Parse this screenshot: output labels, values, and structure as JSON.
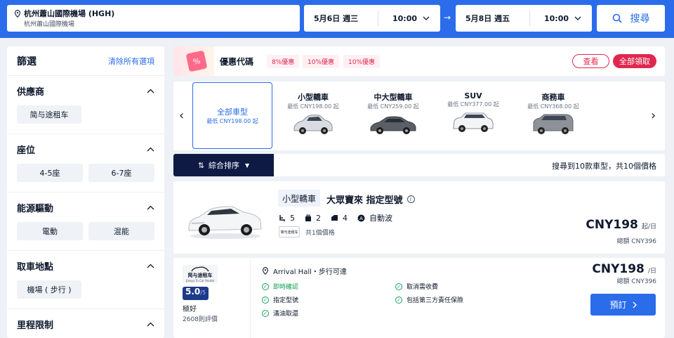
{
  "search": {
    "location_main": "杭州蕭山國際機場 (HGH)",
    "location_sub": "杭州蕭山國際機場",
    "pickup_date": "5月6日 週三",
    "pickup_time": "10:00",
    "return_date": "5月8日 週五",
    "return_time": "10:00",
    "arrow": "→",
    "search_label": "搜尋"
  },
  "filters": {
    "title": "篩選",
    "clear_label": "清除所有選項",
    "sections": [
      {
        "title": "供應商",
        "options": [
          "简与途租车"
        ]
      },
      {
        "title": "座位",
        "options": [
          "4-5座",
          "6-7座"
        ]
      },
      {
        "title": "能源驅動",
        "options": [
          "電動",
          "混能"
        ]
      },
      {
        "title": "取車地點",
        "options": [
          "機場 ( 步行 )"
        ]
      },
      {
        "title": "里程限制",
        "options": []
      }
    ]
  },
  "promo": {
    "title": "優惠代碼",
    "coupons": [
      "8%優惠",
      "10%優惠",
      "10%優惠"
    ],
    "view_label": "查看",
    "claim_label": "全部領取"
  },
  "car_types": [
    {
      "name": "全部車型",
      "price": "最低 CNY198.00 起",
      "icon": "none"
    },
    {
      "name": "小型轎車",
      "price": "最低 CNY198.00 起",
      "icon": "compact-car-icon"
    },
    {
      "name": "中大型轎車",
      "price": "最低 CNY259.00 起",
      "icon": "sedan-icon"
    },
    {
      "name": "SUV",
      "price": "最低 CNY377.00 起",
      "icon": "suv-icon"
    },
    {
      "name": "商務車",
      "price": "最低 CNY368.00 起",
      "icon": "van-icon"
    }
  ],
  "sort": {
    "label": "綜合排序",
    "result_info": "搜尋到10款車型，共10個價格"
  },
  "car": {
    "category": "小型轎車",
    "name": "大眾寶來 指定型號",
    "seats": "5",
    "bags_large": "2",
    "doors": "4",
    "transmission": "自動波",
    "vendor_logo_text": "简与途租车",
    "price_count": "共1個價格",
    "price": "CNY198",
    "per_day": "起/日",
    "total": "總額 CNY396"
  },
  "offer": {
    "vendor_name": "简与途租车",
    "vendor_en": "Jianyu Tu Car Rental",
    "score": "5.0",
    "score_max": "/5",
    "rating_label": "極好",
    "review_count": "2608則評價",
    "pickup_location": "Arrival Hall・步行可達",
    "features": [
      "即時確認",
      "取消需收費",
      "指定型號",
      "包括第三方責任保險",
      "滿油取還"
    ],
    "price": "CNY198",
    "per_day": "/日",
    "total": "總額 CNY396",
    "book_label": "預訂"
  },
  "colors": {
    "brand_blue": "#2a6cea",
    "promo_red": "#e0284f",
    "sort_dark": "#0f1a44",
    "confirm_green": "#16a05a"
  }
}
